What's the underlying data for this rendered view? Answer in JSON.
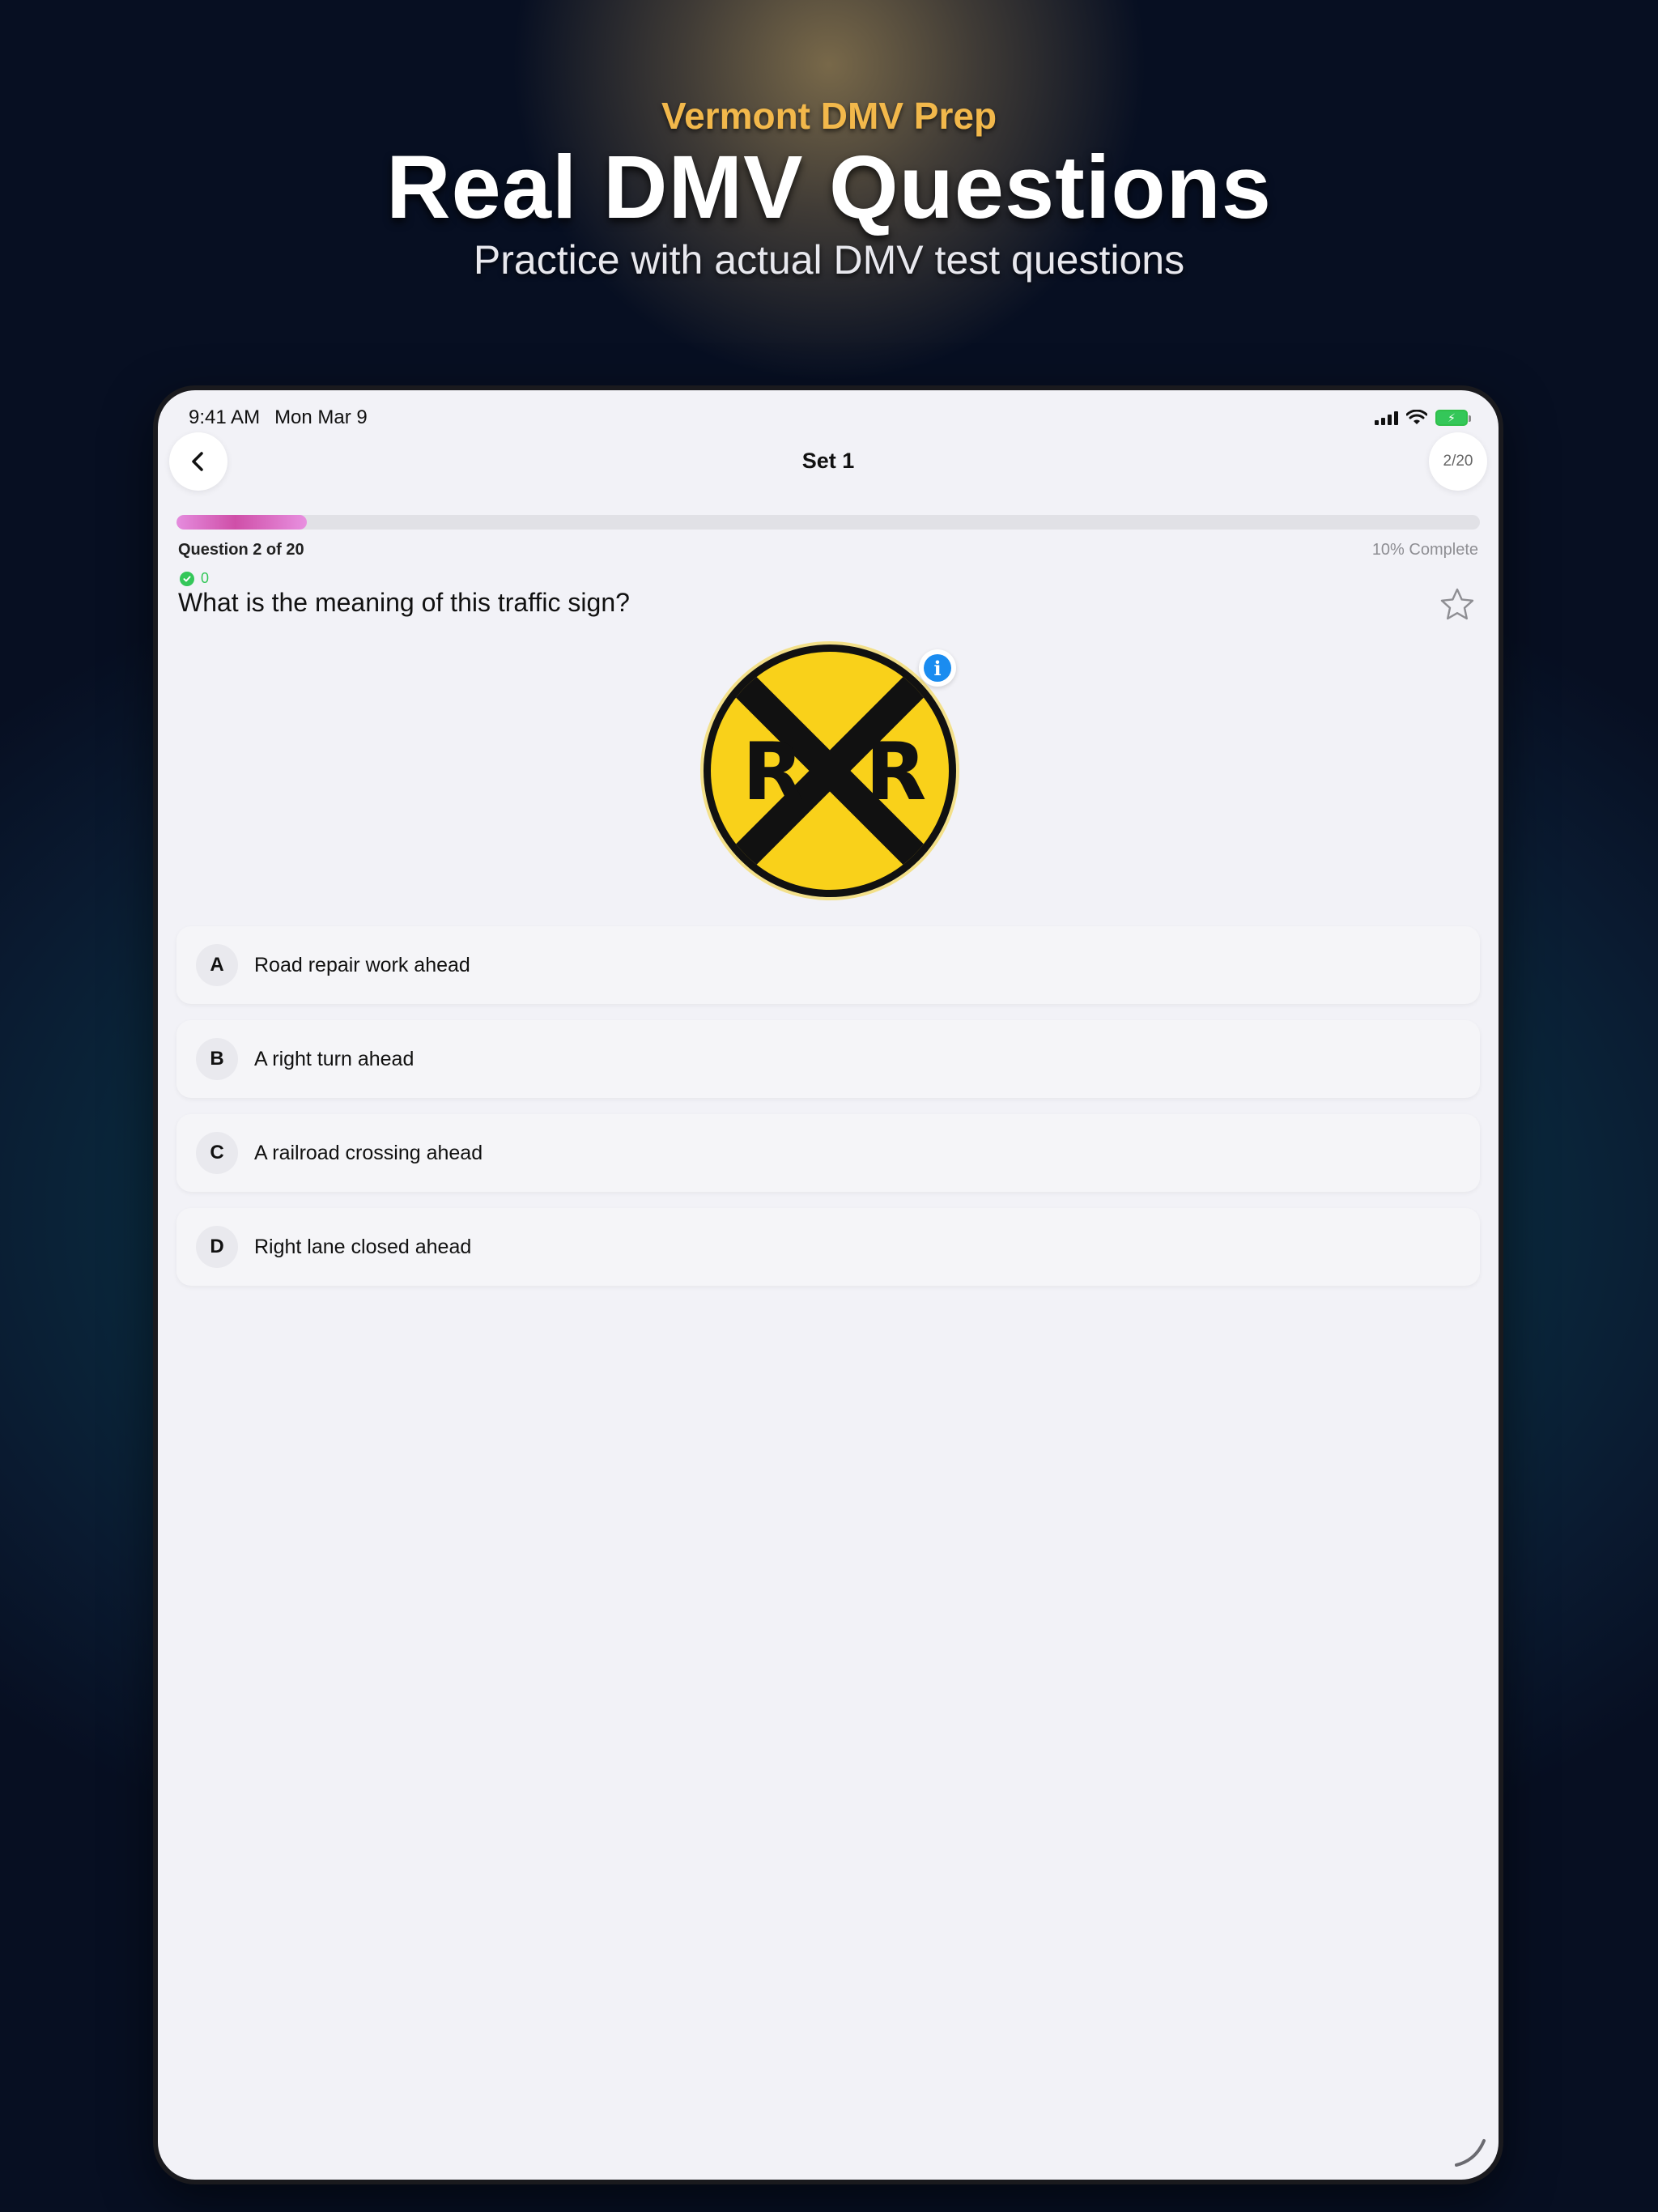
{
  "hero": {
    "brand": "Vermont DMV Prep",
    "title": "Real DMV Questions",
    "subtitle": "Practice with actual DMV test questions"
  },
  "status_bar": {
    "time": "9:41 AM",
    "date": "Mon Mar 9"
  },
  "nav": {
    "title": "Set 1",
    "counter": "2/20",
    "back_icon": "chevron-left-icon"
  },
  "progress": {
    "fraction": 0.1,
    "question_label": "Question 2 of 20",
    "complete_label": "10% Complete",
    "correct_count": "0"
  },
  "question": {
    "text": "What is the meaning of this traffic sign?",
    "sign": "railroad-crossing-sign",
    "sign_letters": [
      "R",
      "R"
    ]
  },
  "options": [
    {
      "letter": "A",
      "text": "Road repair work ahead"
    },
    {
      "letter": "B",
      "text": "A right turn ahead"
    },
    {
      "letter": "C",
      "text": "A railroad crossing ahead"
    },
    {
      "letter": "D",
      "text": "Right lane closed ahead"
    }
  ],
  "colors": {
    "brand_gold": "#f2b84b",
    "progress_pink": "#d85fb8",
    "correct_green": "#34c759",
    "info_blue": "#1a8cf0",
    "sign_yellow": "#f9d11a"
  }
}
